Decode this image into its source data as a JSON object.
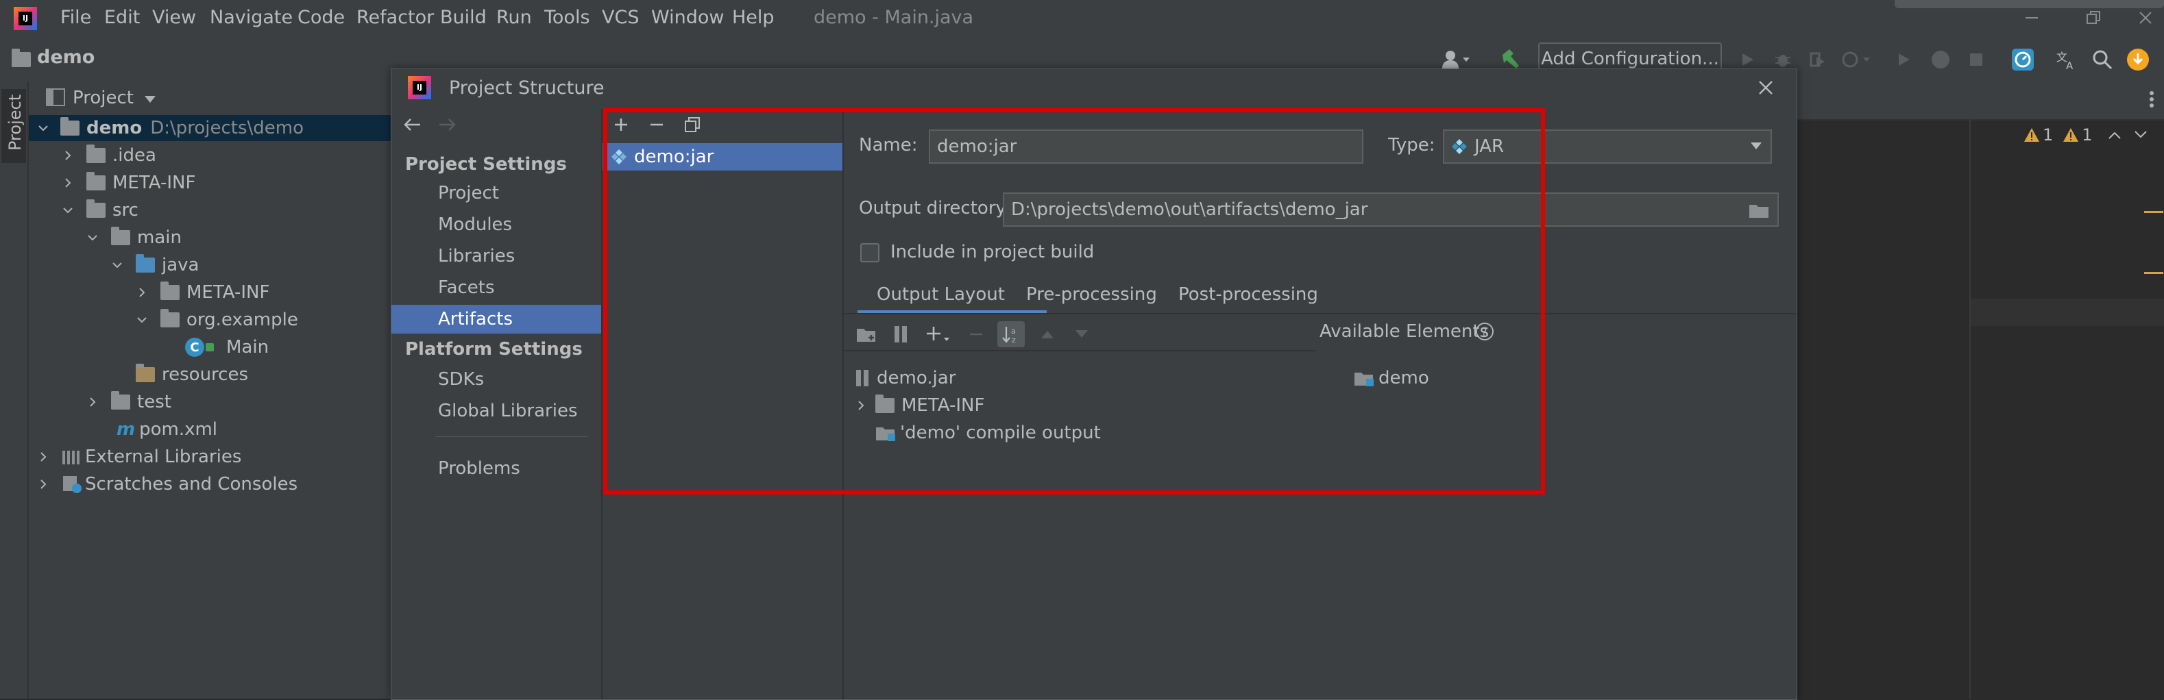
{
  "app": {
    "menus": [
      "File",
      "Edit",
      "View",
      "Navigate",
      "Code",
      "Refactor",
      "Build",
      "Run",
      "Tools",
      "VCS",
      "Window",
      "Help"
    ],
    "window_title": "demo - Main.java",
    "project_name": "demo",
    "run_config": "Add Configuration...",
    "side_tab": "Project"
  },
  "project_panel": {
    "header": "Project",
    "tree": {
      "root_name": "demo",
      "root_path": "D:\\projects\\demo",
      "idea": ".idea",
      "meta_inf": "META-INF",
      "src": "src",
      "main": "main",
      "java": "java",
      "java_meta_inf": "META-INF",
      "package": "org.example",
      "main_class": "Main",
      "resources": "resources",
      "test": "test",
      "pom": "pom.xml",
      "external": "External Libraries",
      "scratches": "Scratches and Consoles"
    }
  },
  "editor": {
    "warn_count_1": "1",
    "warn_count_2": "1"
  },
  "dialog": {
    "title": "Project Structure",
    "project_settings_header": "Project Settings",
    "project_settings": [
      "Project",
      "Modules",
      "Libraries",
      "Facets",
      "Artifacts"
    ],
    "selected_section": "Artifacts",
    "platform_settings_header": "Platform Settings",
    "platform_settings": [
      "SDKs",
      "Global Libraries"
    ],
    "problems": "Problems",
    "artifacts": [
      "demo:jar"
    ],
    "name_label": "Name:",
    "name_value": "demo:jar",
    "type_label": "Type:",
    "type_value": "JAR",
    "output_dir_label": "Output directory:",
    "output_dir_value": "D:\\projects\\demo\\out\\artifacts\\demo_jar",
    "include_label": "Include in project build",
    "include_checked": false,
    "tabs": [
      "Output Layout",
      "Pre-processing",
      "Post-processing"
    ],
    "active_tab": "Output Layout",
    "layout_tree": {
      "jar": "demo.jar",
      "meta_inf": "META-INF",
      "compile_output": "'demo' compile output"
    },
    "available_label": "Available Elements",
    "available_items": [
      "demo"
    ]
  },
  "colors": {
    "selection": "#4b6eaf",
    "highlight_border": "#e00000",
    "accent_blue": "#3592c4",
    "warning": "#d9a343"
  }
}
